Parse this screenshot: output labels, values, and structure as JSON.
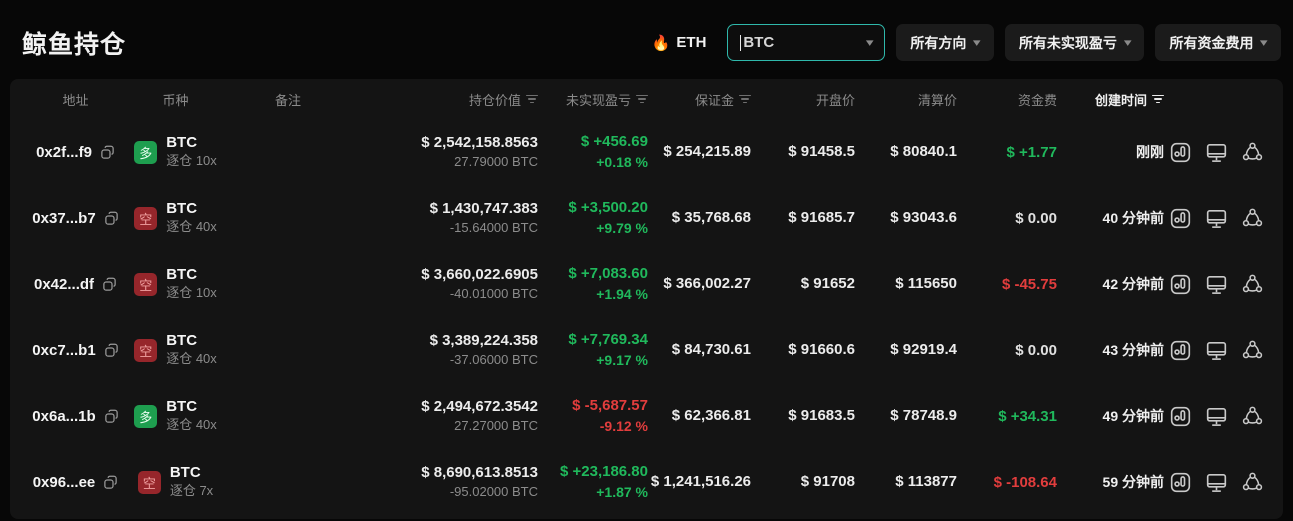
{
  "page": {
    "title": "鲸鱼持仓"
  },
  "filters": {
    "flame_icon": "🔥",
    "hot_coin_label": "ETH",
    "coin_select_value": "BTC",
    "direction_button": "所有方向",
    "pnl_button": "所有未实现盈亏",
    "funding_button": "所有资金费用"
  },
  "colors": {
    "green": "#20b95c",
    "red": "#e23d3d",
    "select_border_teal": "#2fb8ab",
    "long_badge_bg": "#1e9e4f",
    "short_badge_bg": "#96262b",
    "card_bg": "#141414",
    "page_bg": "#070707"
  },
  "table": {
    "headers": {
      "address": "地址",
      "coin": "币种",
      "note": "备注",
      "value": "持仓价值",
      "pnl": "未实现盈亏",
      "margin": "保证金",
      "open": "开盘价",
      "liq": "清算价",
      "funding": "资金费",
      "created": "创建时间"
    },
    "rows": [
      {
        "address": "0x2f...f9",
        "side": "long",
        "side_label": "多",
        "coin": "BTC",
        "mode": "逐仓 10x",
        "value": "$ 2,542,158.8563",
        "amount": "27.79000 BTC",
        "pnl": "$ +456.69",
        "pnl_pct": "+0.18 %",
        "pnl_dir": "up",
        "margin": "$ 254,215.89",
        "open": "$ 91458.5",
        "liq": "$ 80840.1",
        "funding": "$ +1.77",
        "funding_dir": "up",
        "time": "刚刚"
      },
      {
        "address": "0x37...b7",
        "side": "short",
        "side_label": "空",
        "coin": "BTC",
        "mode": "逐仓 40x",
        "value": "$ 1,430,747.383",
        "amount": "-15.64000 BTC",
        "pnl": "$ +3,500.20",
        "pnl_pct": "+9.79 %",
        "pnl_dir": "up",
        "margin": "$ 35,768.68",
        "open": "$ 91685.7",
        "liq": "$ 93043.6",
        "funding": "$ 0.00",
        "funding_dir": "flat",
        "time": "40 分钟前"
      },
      {
        "address": "0x42...df",
        "side": "short",
        "side_label": "空",
        "coin": "BTC",
        "mode": "逐仓 10x",
        "value": "$ 3,660,022.6905",
        "amount": "-40.01000 BTC",
        "pnl": "$ +7,083.60",
        "pnl_pct": "+1.94 %",
        "pnl_dir": "up",
        "margin": "$ 366,002.27",
        "open": "$ 91652",
        "liq": "$ 115650",
        "funding": "$ -45.75",
        "funding_dir": "down",
        "time": "42 分钟前"
      },
      {
        "address": "0xc7...b1",
        "side": "short",
        "side_label": "空",
        "coin": "BTC",
        "mode": "逐仓 40x",
        "value": "$ 3,389,224.358",
        "amount": "-37.06000 BTC",
        "pnl": "$ +7,769.34",
        "pnl_pct": "+9.17 %",
        "pnl_dir": "up",
        "margin": "$ 84,730.61",
        "open": "$ 91660.6",
        "liq": "$ 92919.4",
        "funding": "$ 0.00",
        "funding_dir": "flat",
        "time": "43 分钟前"
      },
      {
        "address": "0x6a...1b",
        "side": "long",
        "side_label": "多",
        "coin": "BTC",
        "mode": "逐仓 40x",
        "value": "$ 2,494,672.3542",
        "amount": "27.27000 BTC",
        "pnl": "$ -5,687.57",
        "pnl_pct": "-9.12 %",
        "pnl_dir": "down",
        "margin": "$ 62,366.81",
        "open": "$ 91683.5",
        "liq": "$ 78748.9",
        "funding": "$ +34.31",
        "funding_dir": "up",
        "time": "49 分钟前"
      },
      {
        "address": "0x96...ee",
        "side": "short",
        "side_label": "空",
        "coin": "BTC",
        "mode": "逐仓 7x",
        "value": "$ 8,690,613.8513",
        "amount": "-95.02000 BTC",
        "pnl": "$ +23,186.80",
        "pnl_pct": "+1.87 %",
        "pnl_dir": "up",
        "margin": "$ 1,241,516.26",
        "open": "$ 91708",
        "liq": "$ 113877",
        "funding": "$ -108.64",
        "funding_dir": "down",
        "time": "59 分钟前"
      }
    ]
  }
}
